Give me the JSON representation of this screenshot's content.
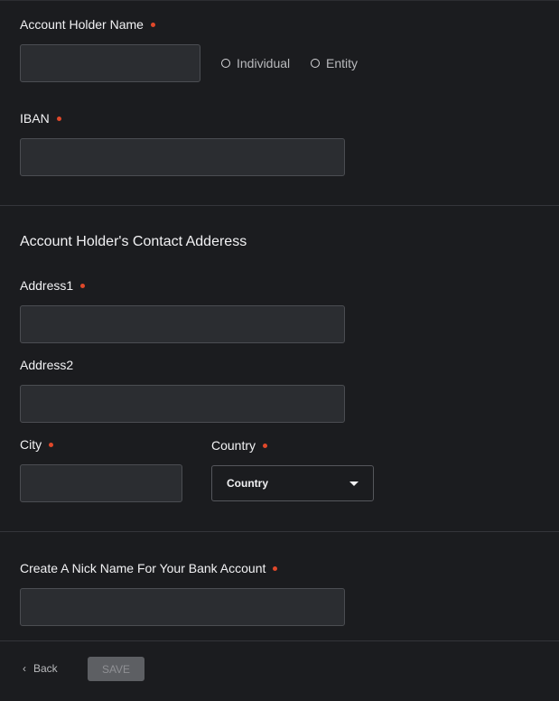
{
  "account_holder": {
    "label": "Account Holder Name",
    "value": "",
    "types": [
      {
        "label": "Individual"
      },
      {
        "label": "Entity"
      }
    ]
  },
  "iban": {
    "label": "IBAN",
    "value": ""
  },
  "contact": {
    "section_title": "Account Holder's Contact Adderess",
    "address1": {
      "label": "Address1",
      "value": ""
    },
    "address2": {
      "label": "Address2",
      "value": ""
    },
    "city": {
      "label": "City",
      "value": ""
    },
    "country": {
      "label": "Country",
      "selected": "Country"
    }
  },
  "nickname": {
    "label": "Create A Nick Name For Your Bank Account",
    "value": ""
  },
  "footer": {
    "back_label": "Back",
    "save_label": "SAVE"
  },
  "colors": {
    "background": "#1b1c1f",
    "input_bg": "#2b2d31",
    "required_dot": "#e0482a",
    "save_disabled": "#5d5f63"
  }
}
